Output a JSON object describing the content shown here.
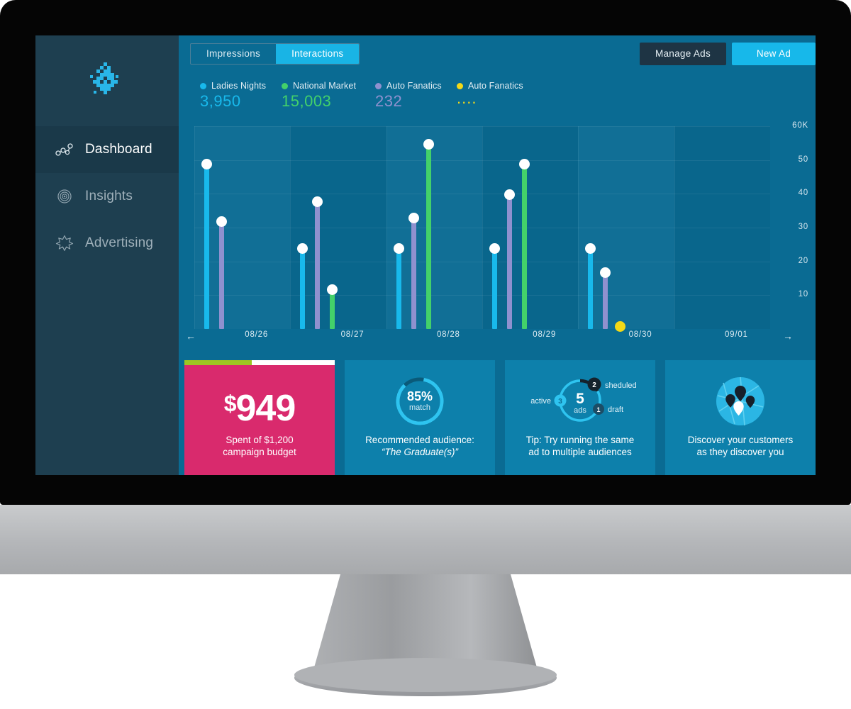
{
  "sidebar": {
    "logo_name": "app-logo",
    "items": [
      {
        "label": "Dashboard",
        "icon": "node-graph-icon",
        "active": true
      },
      {
        "label": "Insights",
        "icon": "target-icon",
        "active": false
      },
      {
        "label": "Advertising",
        "icon": "star-icon",
        "active": false
      }
    ]
  },
  "toolbar": {
    "segments": [
      {
        "label": "Impressions",
        "selected": false
      },
      {
        "label": "Interactions",
        "selected": true
      }
    ],
    "manage_ads_label": "Manage Ads",
    "new_ad_label": "New Ad"
  },
  "legend": [
    {
      "name": "Ladies Nights",
      "value": "3,950",
      "color": "#18b9ec"
    },
    {
      "name": "National Market",
      "value": "15,003",
      "color": "#43d16a"
    },
    {
      "name": "Auto Fanatics",
      "value": "232",
      "color": "#8f91cf"
    },
    {
      "name": "Auto Fanatics",
      "value": "....",
      "color": "#f3d917"
    }
  ],
  "chart_data": {
    "type": "bar",
    "title": "",
    "xlabel": "",
    "ylabel": "",
    "ylim": [
      0,
      60
    ],
    "ytick_labels": [
      "60K",
      "50",
      "40",
      "30",
      "20",
      "10"
    ],
    "ytick_values": [
      60,
      50,
      40,
      30,
      20,
      10
    ],
    "grid": true,
    "legend_position": "top-left",
    "categories": [
      "08/26",
      "08/27",
      "08/28",
      "08/29",
      "08/30",
      "09/01"
    ],
    "series": [
      {
        "name": "Ladies Nights",
        "color": "#18b9ec",
        "values": [
          48,
          23,
          23,
          23,
          23,
          null
        ]
      },
      {
        "name": "Auto Fanatics",
        "color": "#8f91cf",
        "values": [
          31,
          37,
          32,
          39,
          16,
          null
        ]
      },
      {
        "name": "National Market",
        "color": "#43d16a",
        "values": [
          null,
          11,
          54,
          48,
          null,
          null
        ]
      },
      {
        "name": "Auto Fanatics 2",
        "color": "#f3d917",
        "values": [
          null,
          null,
          null,
          null,
          0,
          null
        ]
      }
    ],
    "nav_prev": "←",
    "nav_next": "→"
  },
  "cards": {
    "budget": {
      "currency": "$",
      "amount": "949",
      "caption": "Spent of $1,200",
      "caption2": "campaign budget",
      "progress_pct": 45,
      "bar_color": "#9ec522",
      "bg_color": "#d92a6d"
    },
    "audience": {
      "percent": "85%",
      "sub": "match",
      "caption": "Recommended audience:",
      "quote": "“The Graduate(s)”"
    },
    "ads": {
      "count": "5",
      "sub": "ads",
      "active_label": "active",
      "active_value": "3",
      "scheduled_label": "sheduled",
      "scheduled_value": "2",
      "draft_label": "draft",
      "draft_value": "1",
      "caption": "Tip: Try running the same",
      "caption2": "ad to multiple audiences"
    },
    "discover": {
      "caption": "Discover your customers",
      "caption2": "as they discover you"
    }
  }
}
